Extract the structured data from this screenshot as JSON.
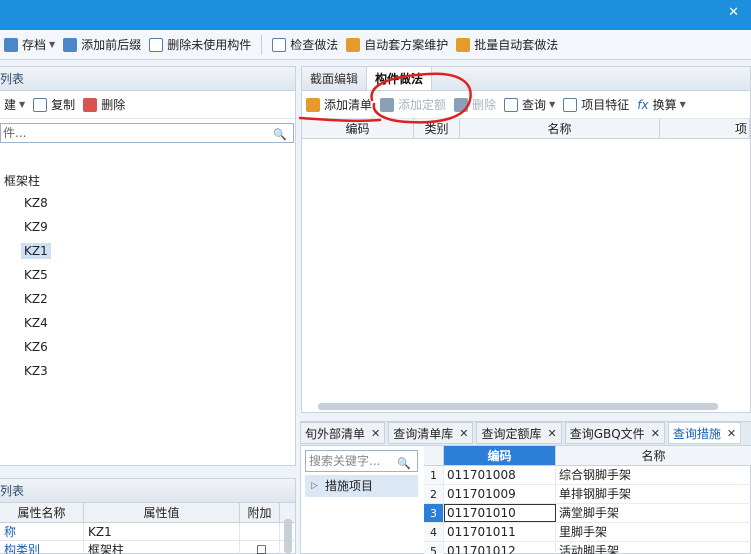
{
  "colors": {
    "title_bar": "#1e8fde",
    "accent": "#2b7fd9",
    "annotation": "#e02020"
  },
  "toolbar": {
    "items": [
      {
        "label": "存档",
        "icon": "save-icon",
        "has_caret": true
      },
      {
        "label": "添加前后缀",
        "icon": "prefix-icon"
      },
      {
        "label": "删除未使用构件",
        "icon": "delete-unused-icon"
      },
      {
        "label": "检查做法",
        "icon": "check-icon"
      },
      {
        "label": "自动套方案维护",
        "icon": "gear-icon"
      },
      {
        "label": "批量自动套做法",
        "icon": "batch-icon"
      }
    ]
  },
  "left": {
    "header_title": "列表",
    "tools": {
      "new_label": "建",
      "copy_label": "复制",
      "delete_label": "删除"
    },
    "search_placeholder": "件...",
    "tree": {
      "parent": "框架柱",
      "children": [
        "KZ8",
        "KZ9",
        "KZ1",
        "KZ5",
        "KZ2",
        "KZ4",
        "KZ6",
        "KZ3"
      ],
      "selected": "KZ1"
    }
  },
  "props": {
    "header_title": "列表",
    "columns": [
      "属性名称",
      "属性值",
      "附加"
    ],
    "rows": [
      {
        "name": "称",
        "value": "KZ1"
      },
      {
        "name": "构类别",
        "value": "框架柱"
      }
    ]
  },
  "right": {
    "tabs": [
      "截面编辑",
      "构件做法"
    ],
    "active_tab": "构件做法",
    "tools": {
      "add_list": "添加清单",
      "add_quota": "添加定额",
      "delete": "删除",
      "query": "查询",
      "feature": "项目特征",
      "convert": "换算"
    },
    "columns": [
      "编码",
      "类别",
      "名称",
      "项"
    ]
  },
  "bottom_tabs": [
    {
      "label": "旬外部清单",
      "active": false
    },
    {
      "label": "查询清单库",
      "active": false
    },
    {
      "label": "查询定额库",
      "active": false
    },
    {
      "label": "查询GBQ文件",
      "active": false
    },
    {
      "label": "查询措施",
      "active": true
    }
  ],
  "bottom": {
    "search_placeholder": "搜索关键字...",
    "tree_item": "措施项目",
    "columns": [
      "编码",
      "名称"
    ],
    "rows": [
      {
        "num": "1",
        "code": "011701008",
        "name": "综合钢脚手架"
      },
      {
        "num": "2",
        "code": "011701009",
        "name": "单排钢脚手架"
      },
      {
        "num": "3",
        "code": "011701010",
        "name": "满堂脚手架"
      },
      {
        "num": "4",
        "code": "011701011",
        "name": "里脚手架"
      },
      {
        "num": "5",
        "code": "011701012",
        "name": "活动脚手架"
      }
    ],
    "selected_row": "3"
  }
}
